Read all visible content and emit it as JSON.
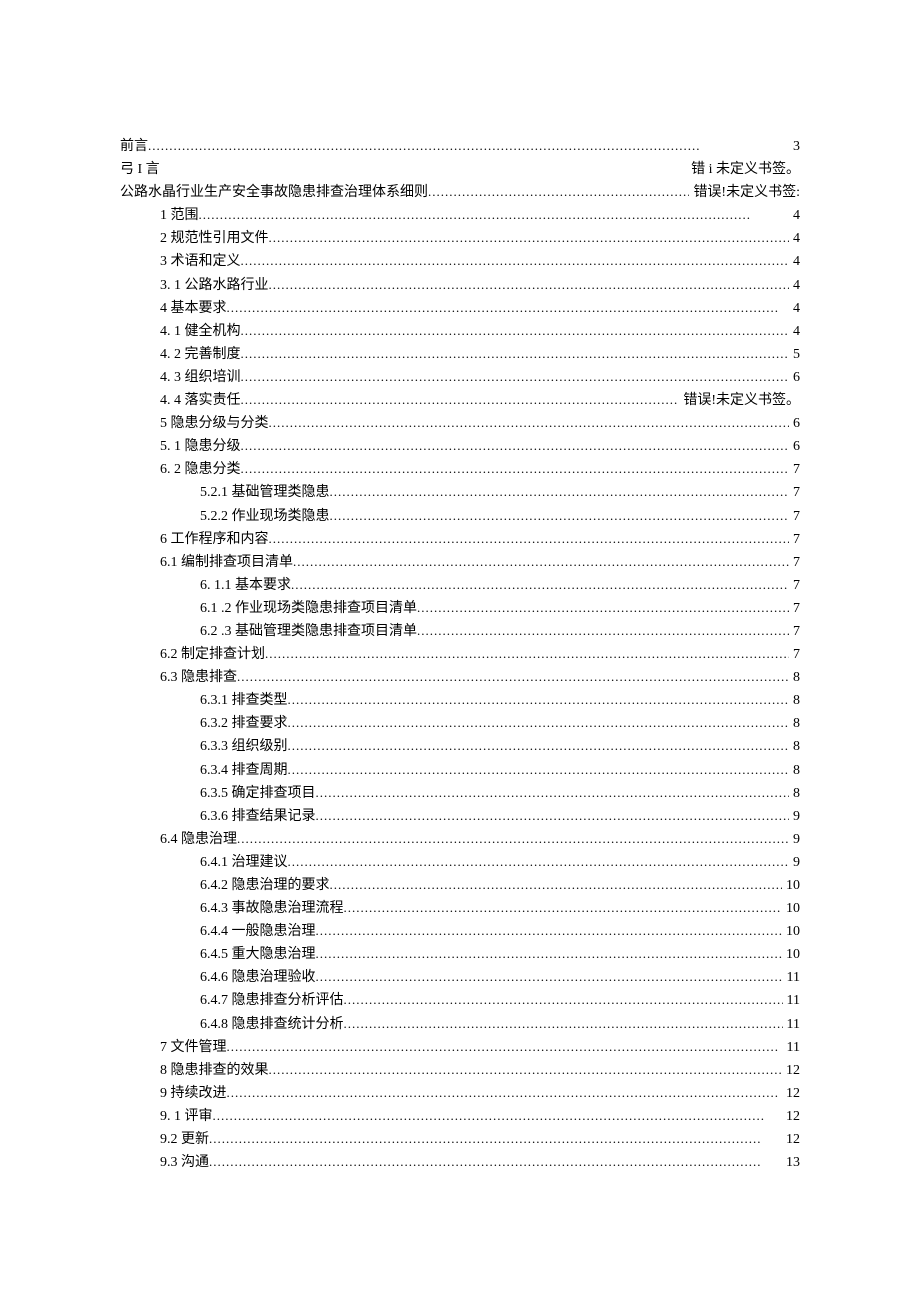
{
  "lines": [
    {
      "indent": 0,
      "label": "前言",
      "page": "3",
      "dots": true
    },
    {
      "indent": 0,
      "twocol": true,
      "left": "弓 I 言",
      "right": "错 i 未定义书签。"
    },
    {
      "indent": 0,
      "label": "公路水晶行业生产安全事故隐患排查治理体系细则",
      "page": "错误!未定义书签:",
      "dots": true
    },
    {
      "indent": 1,
      "label": "1 范围",
      "page": "4",
      "dots": true
    },
    {
      "indent": 1,
      "label": "2 规范性引用文件",
      "page": "4",
      "dots": true
    },
    {
      "indent": 1,
      "label": "3 术语和定义",
      "page": "4",
      "dots": true
    },
    {
      "indent": 1,
      "label": "3. 1 公路水路行业",
      "page": "4",
      "dots": true
    },
    {
      "indent": 1,
      "label": "4 基本要求",
      "page": "4",
      "dots": true
    },
    {
      "indent": 1,
      "label": "4. 1 健全机构",
      "page": "4",
      "dots": true
    },
    {
      "indent": 1,
      "label": "4. 2 完善制度",
      "page": "5",
      "dots": true
    },
    {
      "indent": 1,
      "label": "4. 3 组织培训",
      "page": "6",
      "dots": true
    },
    {
      "indent": 1,
      "label": "4. 4 落实责任",
      "page": "错误!未定义书签。",
      "dots": true
    },
    {
      "indent": 1,
      "label": "5 隐患分级与分类",
      "page": "6",
      "dots": true
    },
    {
      "indent": 1,
      "label": "5. 1 隐患分级",
      "page": "6",
      "dots": true
    },
    {
      "indent": 1,
      "label": "6. 2 隐患分类",
      "page": "7",
      "dots": true
    },
    {
      "indent": 2,
      "label": "5.2.1 基础管理类隐患",
      "page": "7",
      "dots": true
    },
    {
      "indent": 2,
      "label": "5.2.2 作业现场类隐患",
      "page": "7",
      "dots": true
    },
    {
      "indent": 1,
      "label": "6 工作程序和内容",
      "page": "7",
      "dots": true
    },
    {
      "indent": 1,
      "label": "6.1 编制排查项目清单",
      "page": "7",
      "dots": true
    },
    {
      "indent": 2,
      "label": "6. 1.1 基本要求",
      "page": "7",
      "dots": true
    },
    {
      "indent": 2,
      "label": "6.1 .2 作业现场类隐患排查项目清单",
      "page": "7",
      "dots": true
    },
    {
      "indent": 2,
      "label": "6.2 .3 基础管理类隐患排查项目清单",
      "page": "7",
      "dots": true
    },
    {
      "indent": 1,
      "label": "6.2 制定排查计划",
      "page": "7",
      "dots": true
    },
    {
      "indent": 1,
      "label": "6.3 隐患排查",
      "page": "8",
      "dots": true
    },
    {
      "indent": 2,
      "label": "6.3.1 排查类型",
      "page": "8",
      "dots": true
    },
    {
      "indent": 2,
      "label": "6.3.2  排查要求",
      "page": "8",
      "dots": true
    },
    {
      "indent": 2,
      "label": "6.3.3 组织级别",
      "page": "8",
      "dots": true
    },
    {
      "indent": 2,
      "label": "6.3.4 排查周期",
      "page": "8",
      "dots": true
    },
    {
      "indent": 2,
      "label": "6.3.5 确定排查项目",
      "page": "8",
      "dots": true
    },
    {
      "indent": 2,
      "label": "6.3.6 排查结果记录",
      "page": "9",
      "dots": true
    },
    {
      "indent": 1,
      "label": "6.4 隐患治理",
      "page": "9",
      "dots": true
    },
    {
      "indent": 2,
      "label": "6.4.1  治理建议",
      "page": "9",
      "dots": true
    },
    {
      "indent": 2,
      "label": "6.4.2 隐患治理的要求",
      "page": "10",
      "dots": true
    },
    {
      "indent": 2,
      "label": "6.4.3 事故隐患治理流程",
      "page": "10",
      "dots": true
    },
    {
      "indent": 2,
      "label": "6.4.4 一般隐患治理",
      "page": "10",
      "dots": true
    },
    {
      "indent": 2,
      "label": "6.4.5 重大隐患治理",
      "page": "10",
      "dots": true
    },
    {
      "indent": 2,
      "label": "6.4.6 隐患治理验收",
      "page": "11",
      "dots": true
    },
    {
      "indent": 2,
      "label": "6.4.7 隐患排查分析评估",
      "page": "11",
      "dots": true
    },
    {
      "indent": 2,
      "label": "6.4.8 隐患排查统计分析",
      "page": "11",
      "dots": true
    },
    {
      "indent": 1,
      "label": "7 文件管理",
      "page": "11",
      "dots": true
    },
    {
      "indent": 1,
      "label": "8 隐患排查的效果",
      "page": "12",
      "dots": true
    },
    {
      "indent": 1,
      "label": "9 持续改进",
      "page": "12",
      "dots": true
    },
    {
      "indent": 1,
      "label": "9. 1 评审",
      "page": "12",
      "dots": true
    },
    {
      "indent": 1,
      "label": "9.2  更新",
      "page": "12",
      "dots": true
    },
    {
      "indent": 1,
      "label": "9.3  沟通",
      "page": "13",
      "dots": true
    }
  ]
}
